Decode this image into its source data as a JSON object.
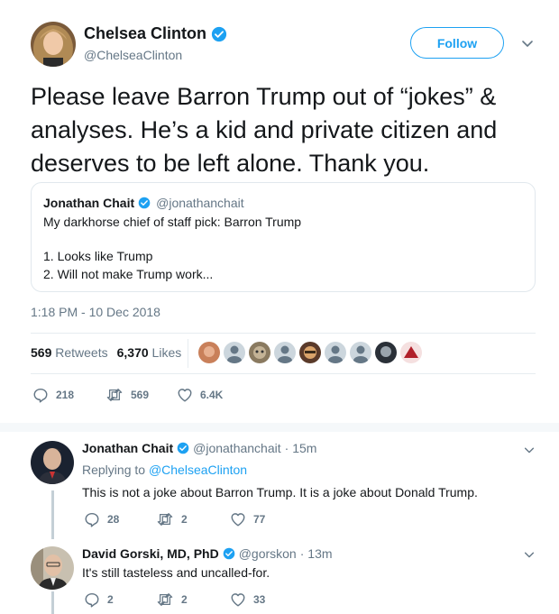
{
  "main_tweet": {
    "author": {
      "name": "Chelsea Clinton",
      "handle": "@ChelseaClinton",
      "verified": true
    },
    "follow_label": "Follow",
    "text": "Please leave Barron Trump out of “jokes” & analyses. He’s a kid and private citizen and deserves to be left alone. Thank you.",
    "quoted": {
      "name": "Jonathan Chait",
      "handle": "@jonathanchait",
      "line1": "My darkhorse chief of staff pick: Barron Trump",
      "line2": "1. Looks like Trump",
      "line3": "2. Will not make Trump work..."
    },
    "timestamp": "1:18 PM - 10 Dec 2018",
    "retweets_count": "569",
    "retweets_label": "Retweets",
    "likes_count": "6,370",
    "likes_label": "Likes",
    "actions": {
      "replies": "218",
      "retweets": "569",
      "likes": "6.4K"
    }
  },
  "replies": [
    {
      "name": "Jonathan Chait",
      "handle": "@jonathanchait",
      "time": "· 15m",
      "replying_prefix": "Replying to",
      "replying_to": "@ChelseaClinton",
      "text": "This is not a joke about Barron Trump. It is a joke about Donald Trump.",
      "actions": {
        "replies": "28",
        "retweets": "2",
        "likes": "77"
      }
    },
    {
      "name": "David Gorski, MD, PhD",
      "handle": "@gorskon",
      "time": "· 13m",
      "text": "It's still tasteless and uncalled-for.",
      "actions": {
        "replies": "2",
        "retweets": "2",
        "likes": "33"
      }
    }
  ],
  "colors": {
    "accent": "#1da1f2",
    "muted": "#657786",
    "text": "#14171a",
    "border": "#e1e8ed"
  },
  "icons": [
    "verified-badge-icon",
    "chevron-down-icon",
    "reply-icon",
    "retweet-icon",
    "like-icon"
  ]
}
